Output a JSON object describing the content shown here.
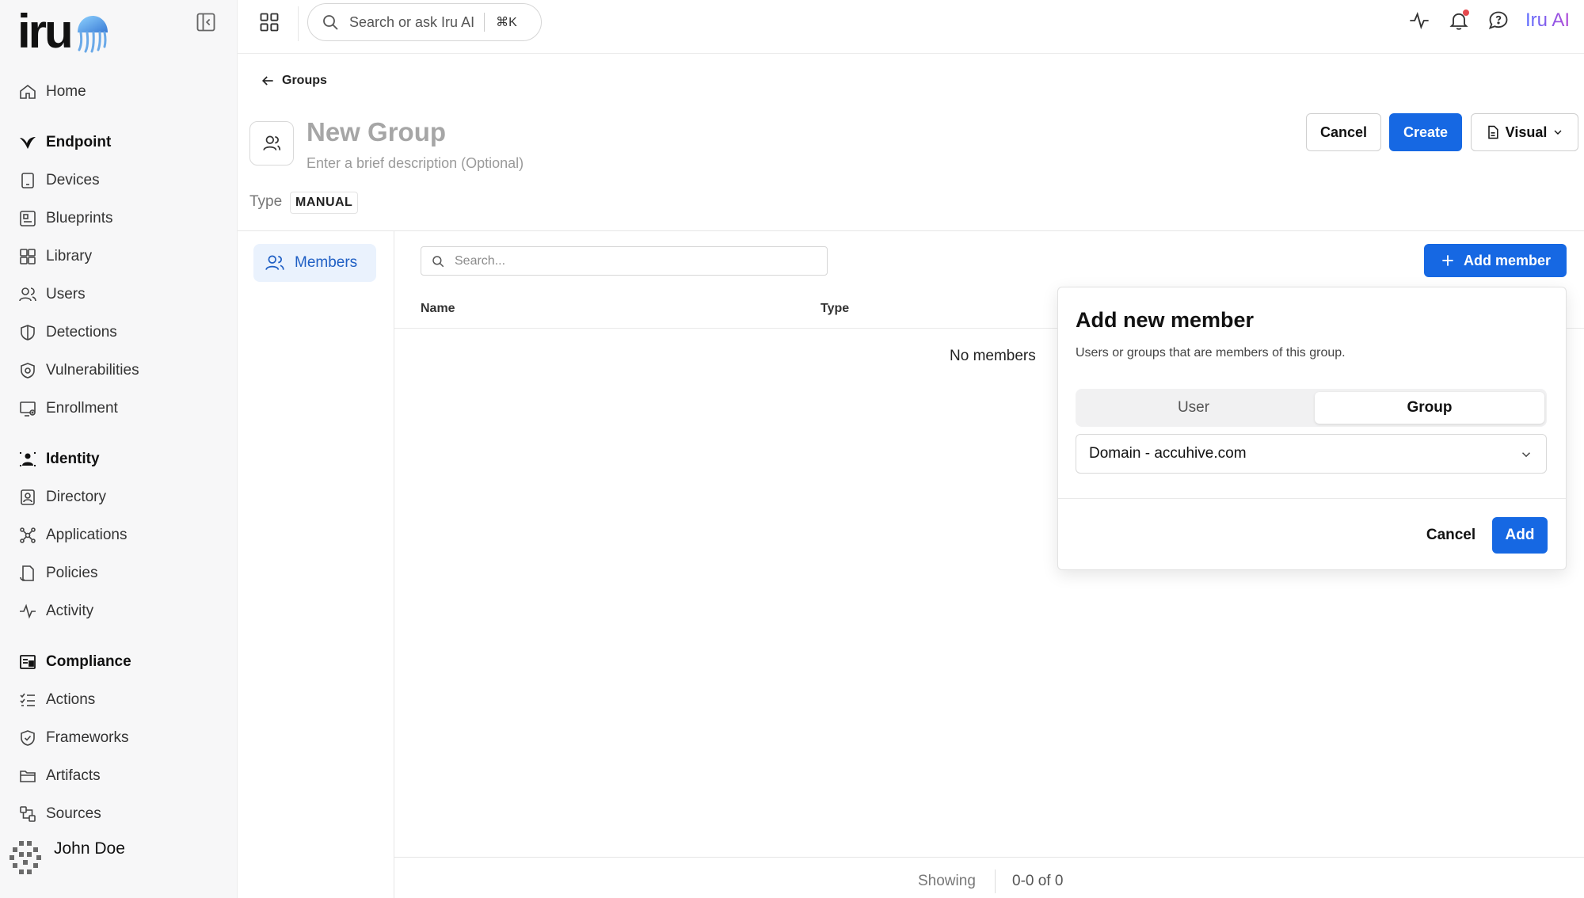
{
  "brand": {
    "logo_text": "iru",
    "ai_label": "Iru AI"
  },
  "topbar": {
    "search_placeholder": "Search or ask Iru AI",
    "shortcut": "⌘K"
  },
  "sidebar": {
    "home": "Home",
    "endpoint": {
      "title": "Endpoint",
      "items": [
        "Devices",
        "Blueprints",
        "Library",
        "Users",
        "Detections",
        "Vulnerabilities",
        "Enrollment"
      ]
    },
    "identity": {
      "title": "Identity",
      "items": [
        "Directory",
        "Applications",
        "Policies",
        "Activity"
      ]
    },
    "compliance": {
      "title": "Compliance",
      "items": [
        "Actions",
        "Frameworks",
        "Artifacts",
        "Sources"
      ]
    },
    "user": {
      "name": "John Doe"
    }
  },
  "header": {
    "back_label": "Groups",
    "title": "New Group",
    "description_placeholder": "Enter a brief description (Optional)",
    "type_label": "Type",
    "type_value": "MANUAL",
    "cancel_label": "Cancel",
    "create_label": "Create",
    "visual_label": "Visual"
  },
  "tabs": {
    "members": "Members"
  },
  "table": {
    "search_placeholder": "Search...",
    "add_member_label": "Add member",
    "columns": [
      "Name",
      "Type"
    ],
    "empty_text": "No members",
    "footer_showing": "Showing",
    "footer_range": "0-0 of 0"
  },
  "popover": {
    "title": "Add new member",
    "subtitle": "Users or groups that are members of this group.",
    "segments": [
      "User",
      "Group"
    ],
    "selected_segment": "Group",
    "select_value": "Domain - accuhive.com",
    "cancel_label": "Cancel",
    "add_label": "Add"
  },
  "colors": {
    "primary": "#1668e3",
    "active_tab_bg": "#eaf2fd",
    "active_tab_text": "#1f5fc4"
  }
}
